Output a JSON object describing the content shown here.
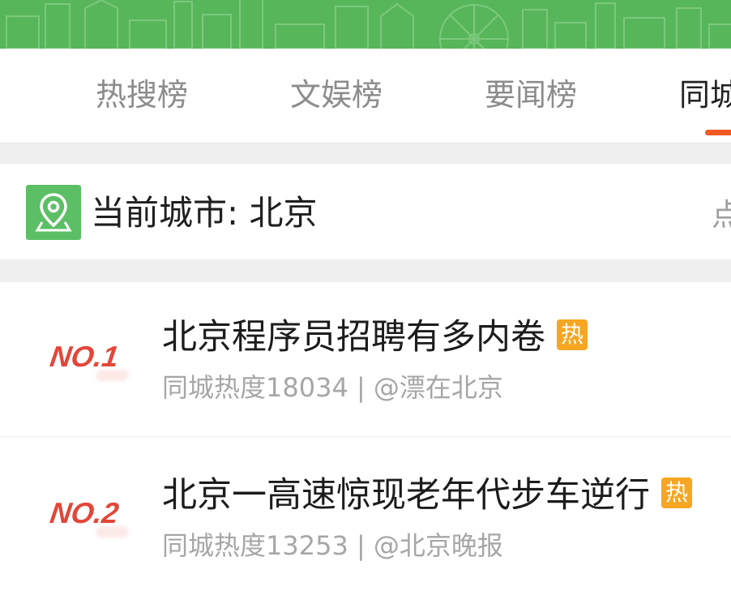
{
  "banner": {
    "color": "#58b65a"
  },
  "tabs": [
    {
      "label": "热搜榜",
      "active": false
    },
    {
      "label": "文娱榜",
      "active": false
    },
    {
      "label": "要闻榜",
      "active": false
    },
    {
      "label": "同城",
      "active": true
    }
  ],
  "city": {
    "label": "当前城市: 北京",
    "action": "点",
    "icon": "location-pin-icon"
  },
  "list": [
    {
      "rank": "NO.1",
      "title": "北京程序员招聘有多内卷",
      "badge": "热",
      "meta": "同城热度18034 | @漂在北京"
    },
    {
      "rank": "NO.2",
      "title": "北京一高速惊现老年代步车逆行",
      "badge": "热",
      "meta": "同城热度13253 | @北京晚报"
    }
  ],
  "colors": {
    "accent": "#f05a22",
    "rank": "#e2473a",
    "badge": "#f6a623",
    "pin": "#5cbf66"
  }
}
